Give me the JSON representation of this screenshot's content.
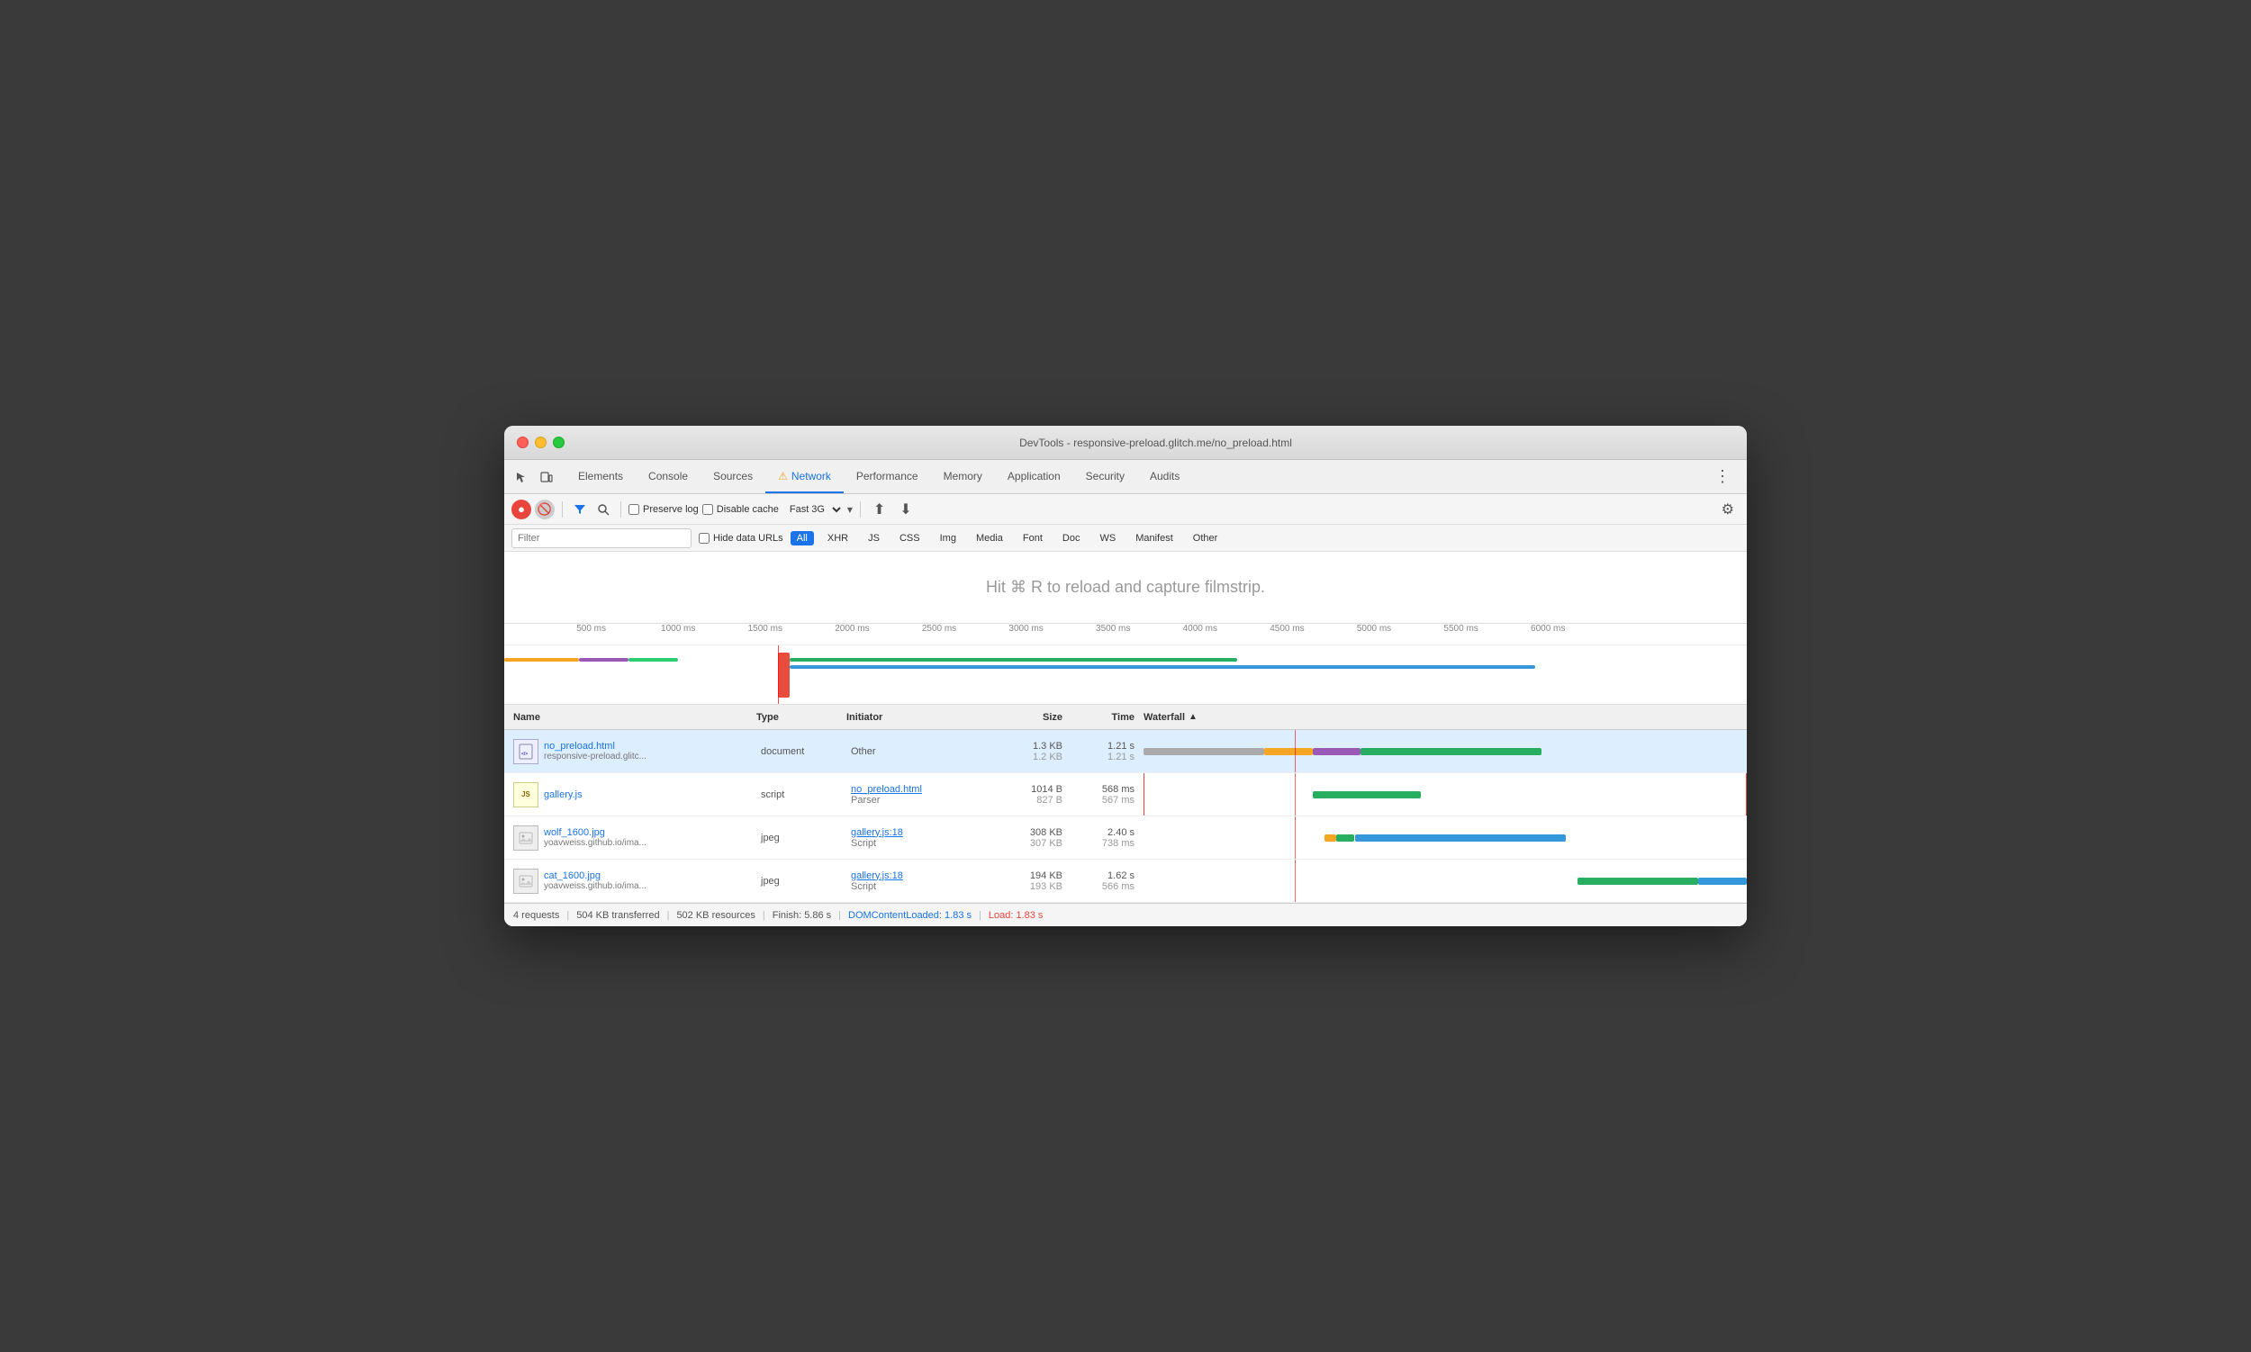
{
  "window": {
    "title": "DevTools - responsive-preload.glitch.me/no_preload.html"
  },
  "tabs": {
    "items": [
      {
        "label": "Elements",
        "active": false
      },
      {
        "label": "Console",
        "active": false
      },
      {
        "label": "Sources",
        "active": false
      },
      {
        "label": "Network",
        "active": true,
        "warn": true
      },
      {
        "label": "Performance",
        "active": false
      },
      {
        "label": "Memory",
        "active": false
      },
      {
        "label": "Application",
        "active": false
      },
      {
        "label": "Security",
        "active": false
      },
      {
        "label": "Audits",
        "active": false
      }
    ]
  },
  "toolbar": {
    "preserve_log": "Preserve log",
    "disable_cache": "Disable cache",
    "throttle": "Fast 3G",
    "filter_placeholder": "Filter"
  },
  "filter_types": [
    "All",
    "XHR",
    "JS",
    "CSS",
    "Img",
    "Media",
    "Font",
    "Doc",
    "WS",
    "Manifest",
    "Other"
  ],
  "filmstrip": {
    "hint": "Hit ⌘ R to reload and capture filmstrip."
  },
  "timeline": {
    "ticks": [
      "500 ms",
      "1000 ms",
      "1500 ms",
      "2000 ms",
      "2500 ms",
      "3000 ms",
      "3500 ms",
      "4000 ms",
      "4500 ms",
      "5000 ms",
      "5500 ms",
      "6000 ms"
    ]
  },
  "table": {
    "headers": {
      "name": "Name",
      "type": "Type",
      "initiator": "Initiator",
      "size": "Size",
      "time": "Time",
      "waterfall": "Waterfall"
    },
    "rows": [
      {
        "icon_type": "html",
        "name_main": "no_preload.html",
        "name_sub": "responsive-preload.glitc...",
        "type": "document",
        "initiator_main": "Other",
        "initiator_sub": "",
        "size1": "1.3 KB",
        "size2": "1.2 KB",
        "time1": "1.21 s",
        "time2": "1.21 s",
        "selected": true
      },
      {
        "icon_type": "js",
        "name_main": "gallery.js",
        "name_sub": "",
        "type": "script",
        "initiator_main": "no_preload.html",
        "initiator_sub": "Parser",
        "size1": "1014 B",
        "size2": "827 B",
        "time1": "568 ms",
        "time2": "567 ms",
        "selected": false
      },
      {
        "icon_type": "img",
        "name_main": "wolf_1600.jpg",
        "name_sub": "yoavweiss.github.io/ima...",
        "type": "jpeg",
        "initiator_main": "gallery.js:18",
        "initiator_sub": "Script",
        "size1": "308 KB",
        "size2": "307 KB",
        "time1": "2.40 s",
        "time2": "738 ms",
        "selected": false
      },
      {
        "icon_type": "img",
        "name_main": "cat_1600.jpg",
        "name_sub": "yoavweiss.github.io/ima...",
        "type": "jpeg",
        "initiator_main": "gallery.js:18",
        "initiator_sub": "Script",
        "size1": "194 KB",
        "size2": "193 KB",
        "time1": "1.62 s",
        "time2": "566 ms",
        "selected": false
      }
    ]
  },
  "status": {
    "requests": "4 requests",
    "transferred": "504 KB transferred",
    "resources": "502 KB resources",
    "finish": "Finish: 5.86 s",
    "dcl": "DOMContentLoaded: 1.83 s",
    "load": "Load: 1.83 s"
  }
}
